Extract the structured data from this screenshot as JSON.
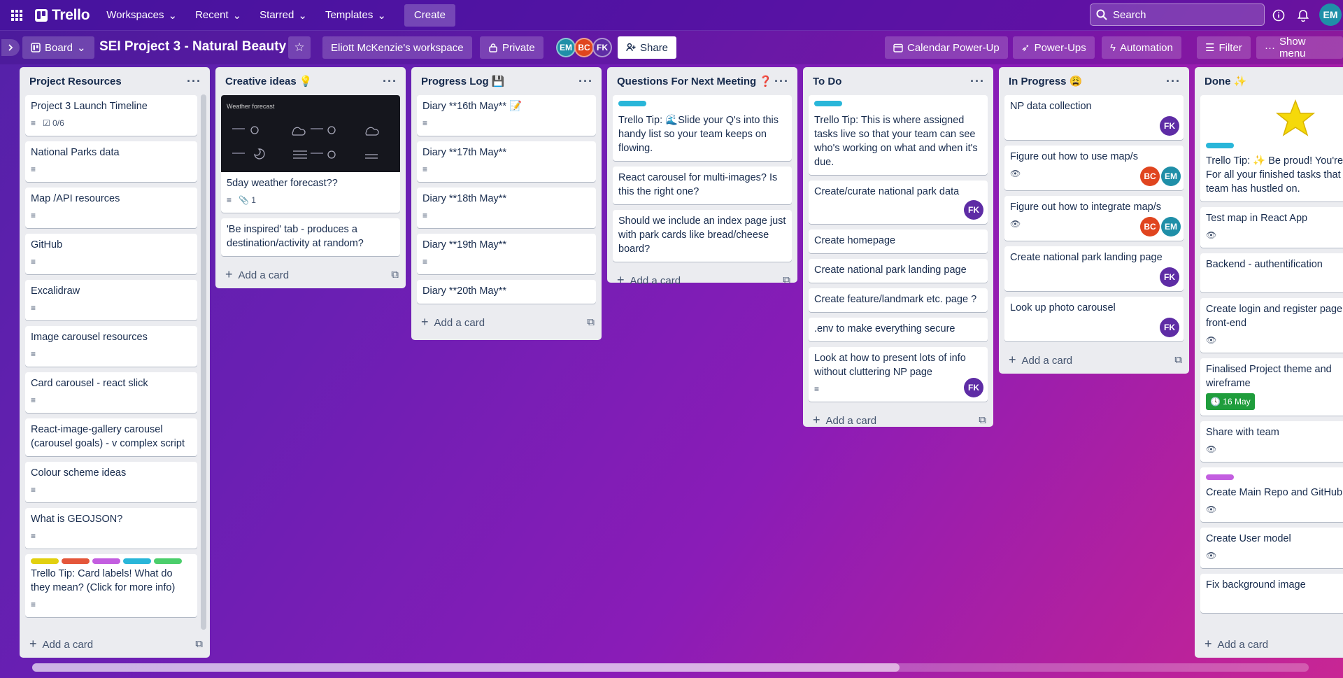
{
  "topnav": {
    "logo": "Trello",
    "workspaces": "Workspaces",
    "recent": "Recent",
    "starred": "Starred",
    "templates": "Templates",
    "create": "Create",
    "search_placeholder": "Search",
    "user_initials": "EM"
  },
  "board": {
    "view": "Board",
    "title": "SEI Project 3 - Natural Beauty",
    "workspace": "Eliott McKenzie's workspace",
    "visibility": "Private",
    "members": [
      "EM",
      "BC",
      "FK"
    ],
    "share": "Share",
    "calendar": "Calendar Power-Up",
    "powerups": "Power-Ups",
    "automation": "Automation",
    "filter": "Filter",
    "show_menu": "Show menu"
  },
  "add_card": "Add a card",
  "lists": {
    "resources": {
      "title": "Project Resources",
      "cards": [
        "Project 3 Launch Timeline",
        "National Parks data",
        "Map /API resources",
        "GitHub",
        "Excalidraw",
        "Image carousel resources",
        "Card carousel - react slick",
        "React-image-gallery carousel (carousel goals) - v complex script",
        "Colour scheme ideas",
        "What is GEOJSON?",
        "Trello Tip: Card labels! What do they mean? (Click for more info)"
      ],
      "checklist": "0/6"
    },
    "creative": {
      "title": "Creative ideas 💡",
      "cards": [
        "5day weather forecast??",
        "'Be inspired' tab - produces a destination/activity at random?"
      ],
      "attachments": "1",
      "thumb_title": "Weather forecast"
    },
    "progress": {
      "title": "Progress Log 💾",
      "cards": [
        "Diary **16th May** 📝",
        "Diary **17th May**",
        "Diary **18th May**",
        "Diary **19th May**",
        "Diary **20th May**"
      ]
    },
    "questions": {
      "title": "Questions For Next Meeting ❓",
      "cards": [
        "Trello Tip: 🌊Slide your Q's into this handy list so your team keeps on flowing.",
        "React carousel for multi-images? Is this the right one?",
        "Should we include an index page just with park cards like bread/cheese board?"
      ]
    },
    "todo": {
      "title": "To Do",
      "cards": [
        "Trello Tip: This is where assigned tasks live so that your team can see who's working on what and when it's due.",
        "Create/curate national park data",
        "Create homepage",
        "Create national park landing page",
        "Create feature/landmark etc. page ?",
        ".env to make everything secure",
        "Look at how to present lots of info without cluttering NP page"
      ]
    },
    "inprogress": {
      "title": "In Progress 😩",
      "cards": [
        "NP data collection",
        "Figure out how to use map/s",
        "Figure out how to integrate map/s",
        "Create national park landing page",
        "Look up photo carousel"
      ]
    },
    "done": {
      "title": "Done ✨",
      "cards": [
        "Trello Tip: ✨ Be proud! You're done! For all your finished tasks that your team has hustled on.",
        "Test map in React App",
        "Backend - authentification",
        "Create login and register page front-end",
        "Finalised Project theme and wireframe",
        "Share with team",
        "Create Main Repo and GitHub",
        "Create User model",
        "Fix background image"
      ],
      "due": "16 May"
    }
  },
  "avatars": {
    "fk": "FK",
    "bc": "BC",
    "em": "EM"
  },
  "colors": {
    "label_yellow": "#e2d00f",
    "label_red": "#e4563a",
    "label_purple": "#c35ee0",
    "label_blue": "#29b6d9",
    "label_green": "#4bce6b",
    "due_green": "#1f9d3c"
  }
}
